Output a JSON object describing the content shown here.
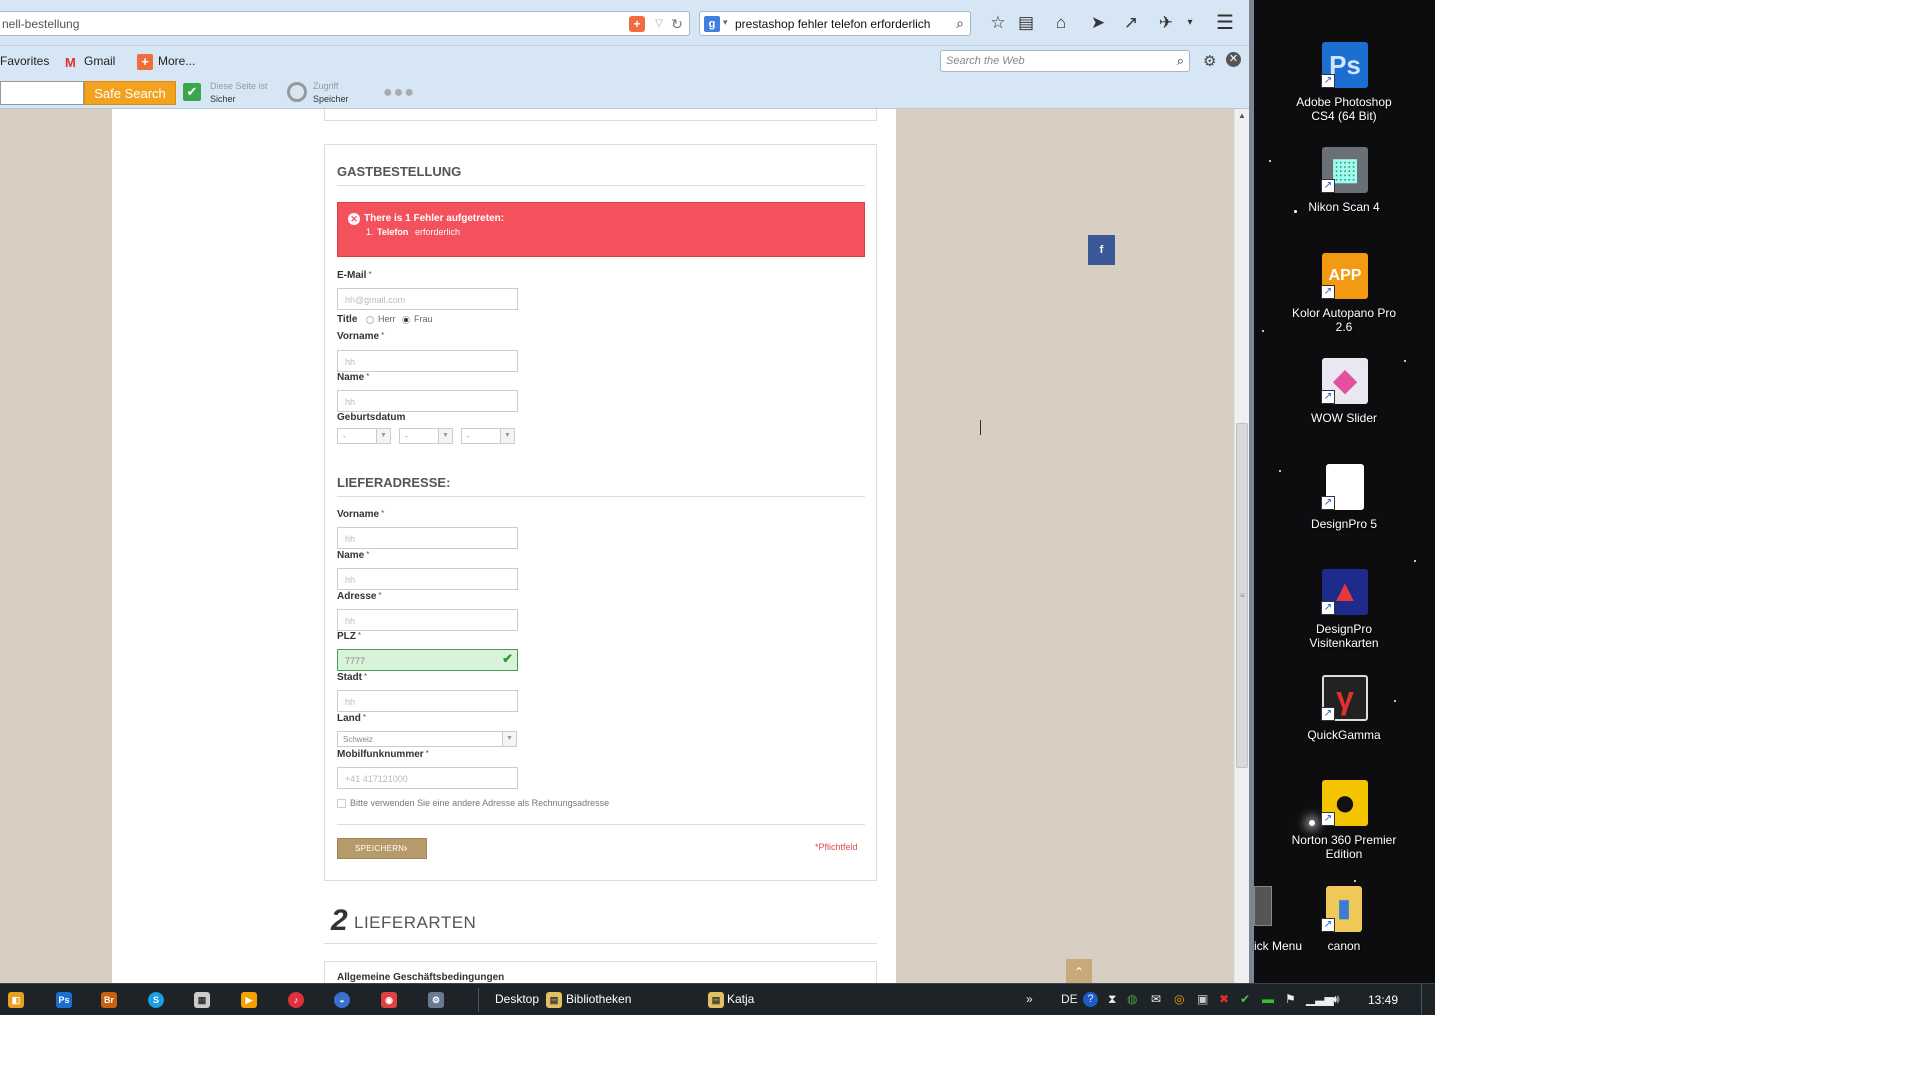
{
  "browser": {
    "url": "nell-bestellung",
    "search_query": "prestashop fehler telefon erforderlich",
    "icons": [
      "star-icon",
      "bookmarks-list-icon",
      "home-icon",
      "send-icon",
      "pin-icon",
      "addon-icon",
      "menu-icon"
    ]
  },
  "bookmarks": {
    "favorites": "Favorites",
    "gmail": "Gmail",
    "more": "More...",
    "web_search_placeholder": "Search the Web"
  },
  "security_toolbar": {
    "safe_search": "Safe Search",
    "site_status_line1": "Diese Seite ist",
    "site_status_line2": "Sicher",
    "access_line1": "Zugriff",
    "access_line2": "Speicher"
  },
  "checkout": {
    "guest_title": "GASTBESTELLUNG",
    "error": {
      "title": "There is 1 Fehler aufgetreten:",
      "number": "1.",
      "field": "Telefon",
      "message": "erforderlich"
    },
    "required_mark": "*",
    "email_label": "E-Mail",
    "email_value": "hh@gmail.com",
    "title_label": "Title",
    "title_options": [
      "Herr",
      "Frau"
    ],
    "title_selected": "Frau",
    "firstname_label": "Vorname",
    "firstname_value": "hh",
    "lastname_label": "Name",
    "lastname_value": "hh",
    "birthdate_label": "Geburtsdatum",
    "birthdate_day": "-",
    "birthdate_month": "-",
    "birthdate_year": "-",
    "delivery_title": "LIEFERADRESSE:",
    "delivery": {
      "firstname_label": "Vorname",
      "firstname_value": "hh",
      "lastname_label": "Name",
      "lastname_value": "hh",
      "address_label": "Adresse",
      "address_value": "hh",
      "zip_label": "PLZ",
      "zip_value": "7777",
      "city_label": "Stadt",
      "city_value": "hh",
      "country_label": "Land",
      "country_value": "Schweiz",
      "mobile_label": "Mobilfunknummer",
      "mobile_value": "+41 417121000"
    },
    "invoice_checkbox_label": "Bitte verwenden Sie eine andere Adresse als Rechnungsadresse",
    "save_button": "SPEICHERN",
    "required_note": "*Pflichtfeld",
    "step2_number": "2",
    "step2_title": "LIEFERARTEN",
    "terms_title": "Allgemeine Geschäftsbedingungen"
  },
  "desktop_icons": [
    {
      "label": "Adobe Photoshop CS4 (64 Bit)",
      "icon": "photoshop-icon",
      "glyph": "Ps",
      "color": "#1c6fd0"
    },
    {
      "label": "Nikon Scan 4",
      "icon": "nikon-scan-icon",
      "glyph": "▦",
      "color": "#6b7077"
    },
    {
      "label": "Kolor Autopano Pro 2.6",
      "icon": "autopano-icon",
      "glyph": "APP",
      "color": "#f39a12"
    },
    {
      "label": "WOW Slider",
      "icon": "wow-slider-icon",
      "glyph": "◆",
      "color": "#e8e8f0"
    },
    {
      "label": "DesignPro 5",
      "icon": "designpro-icon",
      "glyph": "",
      "color": "#ffffff"
    },
    {
      "label": "DesignPro Visitenkarten",
      "icon": "designpro-cards-icon",
      "glyph": "▲",
      "color": "#1e2a8c"
    },
    {
      "label": "QuickGamma",
      "icon": "quickgamma-icon",
      "glyph": "γ",
      "color": "#222222"
    },
    {
      "label": "Norton 360 Premier Edition",
      "icon": "norton-icon",
      "glyph": "●",
      "color": "#f5c400"
    },
    {
      "label": "canon",
      "icon": "folder-icon",
      "glyph": "▮",
      "color": "#f0c858"
    }
  ],
  "partial_desktop_icon": "ick Menu",
  "taskbar": {
    "apps": [
      "Desktop",
      "Bibliotheken",
      "Katja"
    ],
    "language": "DE",
    "time": "13:49"
  }
}
